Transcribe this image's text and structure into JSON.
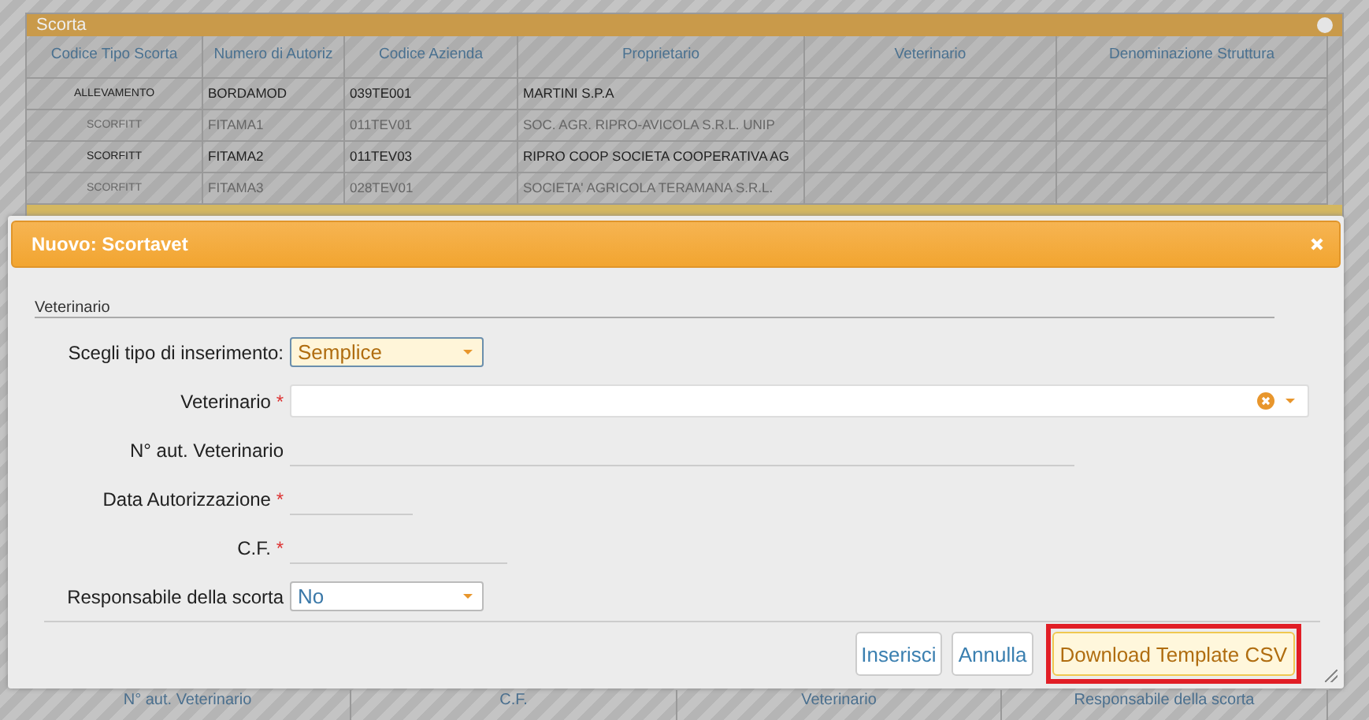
{
  "panel": {
    "title": "Scorta",
    "columns": [
      "Codice Tipo Scorta",
      "Numero di Autoriz",
      "Codice Azienda",
      "Proprietario",
      "Veterinario",
      "Denominazione Struttura"
    ],
    "rows": [
      {
        "bold": true,
        "cells": [
          "ALLEVAMENTO",
          "BORDAMOD",
          "039TE001",
          "MARTINI S.P.A",
          "",
          ""
        ]
      },
      {
        "bold": false,
        "cells": [
          "SCORFITT",
          "FITAMA1",
          "011TEV01",
          "SOC. AGR. RIPRO-AVICOLA S.R.L. UNIP",
          "",
          ""
        ]
      },
      {
        "bold": true,
        "cells": [
          "SCORFITT",
          "FITAMA2",
          "011TEV03",
          "RIPRO COOP SOCIETA COOPERATIVA AG",
          "",
          ""
        ]
      },
      {
        "bold": false,
        "cells": [
          "SCORFITT",
          "FITAMA3",
          "028TEV01",
          "SOCIETA' AGRICOLA TERAMANA S.R.L.",
          "",
          ""
        ]
      }
    ]
  },
  "lower_table": {
    "columns": [
      "N° aut. Veterinario",
      "C.F.",
      "Veterinario",
      "Responsabile della scorta"
    ]
  },
  "dialog": {
    "title": "Nuovo: Scortavet",
    "section": "Veterinario",
    "fields": [
      {
        "kind": "select",
        "label": "Scegli tipo di inserimento:",
        "value": "Semplice",
        "focused": true
      },
      {
        "kind": "combo",
        "label": "Veterinario",
        "required_mark": "*"
      },
      {
        "kind": "text",
        "label": "N° aut. Veterinario"
      },
      {
        "kind": "text",
        "label": "Data Autorizzazione",
        "required_mark": "*"
      },
      {
        "kind": "text",
        "label": "C.F.",
        "required_mark": "*"
      },
      {
        "kind": "select",
        "label": "Responsabile della scorta",
        "value": "No",
        "focused": false
      }
    ],
    "buttons": [
      {
        "label": "Inserisci",
        "primary": false,
        "highlighted": false
      },
      {
        "label": "Annulla",
        "primary": false,
        "highlighted": false
      },
      {
        "label": "Download Template CSV",
        "primary": true,
        "highlighted": true
      }
    ]
  }
}
